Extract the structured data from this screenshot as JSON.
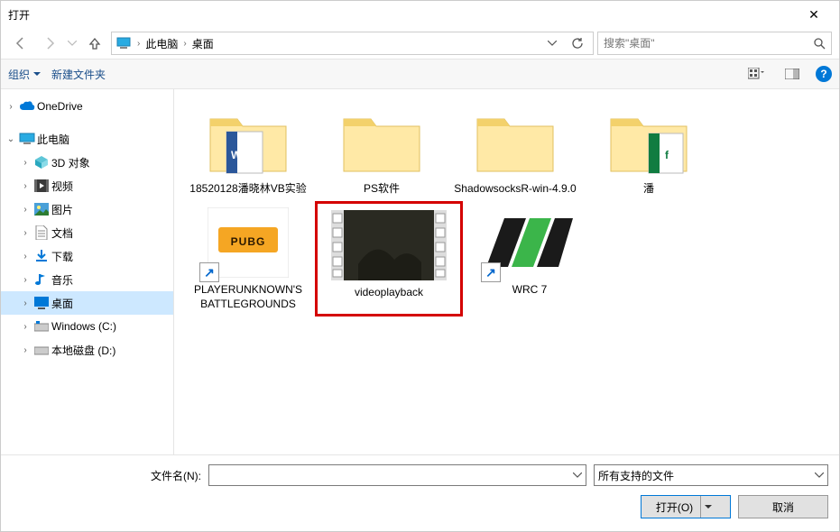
{
  "title": "打开",
  "breadcrumb": {
    "root": "此电脑",
    "current": "桌面"
  },
  "search": {
    "placeholder": "搜索\"桌面\""
  },
  "toolbar": {
    "organize": "组织",
    "newfolder": "新建文件夹"
  },
  "tree": {
    "onedrive": "OneDrive",
    "thispc": "此电脑",
    "items": [
      {
        "label": "3D 对象"
      },
      {
        "label": "视频"
      },
      {
        "label": "图片"
      },
      {
        "label": "文档"
      },
      {
        "label": "下载"
      },
      {
        "label": "音乐"
      },
      {
        "label": "桌面"
      },
      {
        "label": "Windows (C:)"
      },
      {
        "label": "本地磁盘 (D:)"
      }
    ]
  },
  "files": [
    {
      "label": "18520128潘晓林VB实验",
      "type": "folder-doc"
    },
    {
      "label": "PS软件",
      "type": "folder"
    },
    {
      "label": "ShadowsocksR-win-4.9.0",
      "type": "folder"
    },
    {
      "label": "潘",
      "type": "folder-xls"
    },
    {
      "label": "PLAYERUNKNOWN'S BATTLEGROUNDS",
      "type": "pubg",
      "shortcut": true
    },
    {
      "label": "videoplayback",
      "type": "video",
      "highlight": true
    },
    {
      "label": "WRC 7",
      "type": "wrc",
      "shortcut": true
    }
  ],
  "bottom": {
    "filename_label": "文件名(N):",
    "filename_value": "",
    "filter": "所有支持的文件",
    "open": "打开(O)",
    "cancel": "取消"
  }
}
